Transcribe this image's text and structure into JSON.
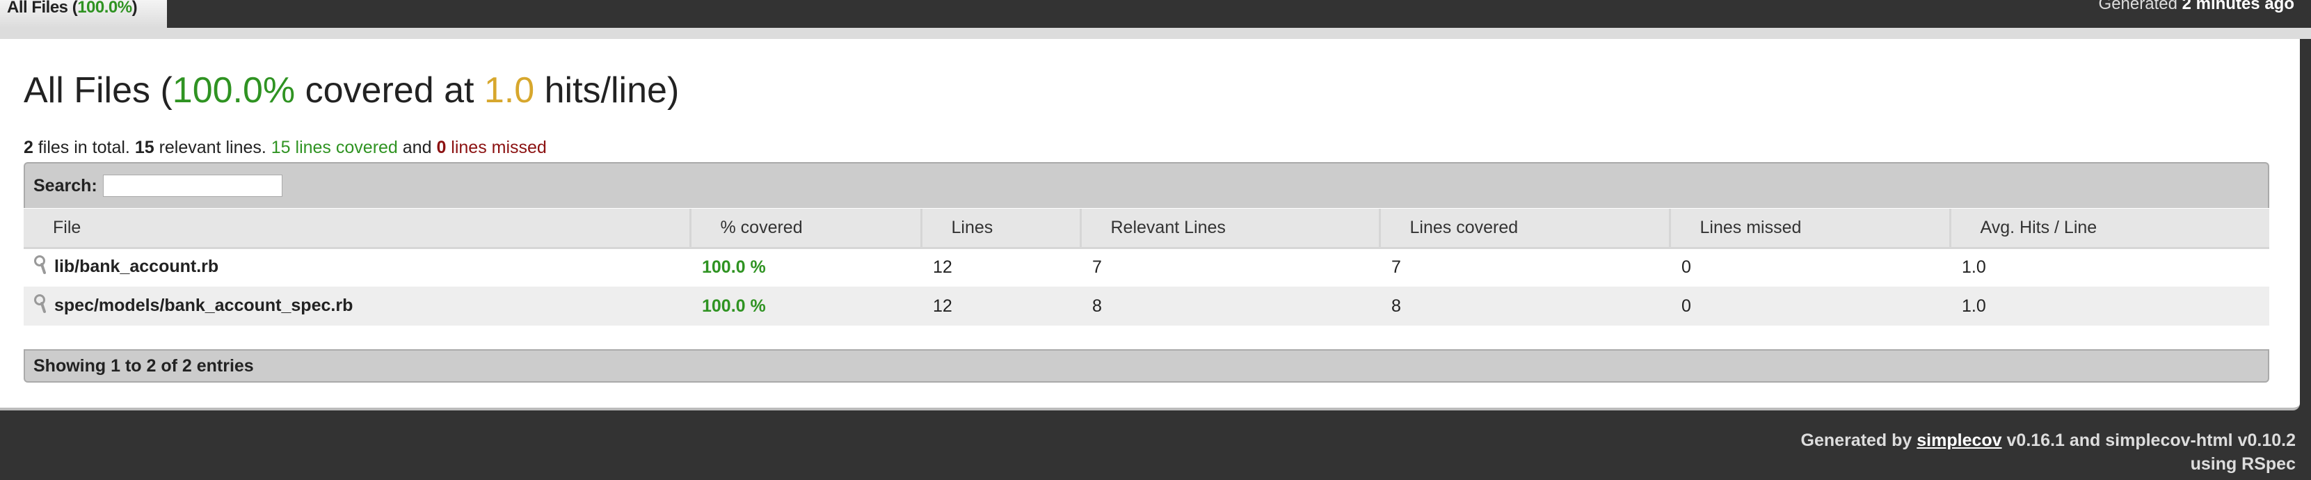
{
  "tab": {
    "label": "All Files",
    "pct": "100.0%"
  },
  "timestamp": {
    "prefix": "Generated",
    "value": "2 minutes ago"
  },
  "title": {
    "prefix": "All Files (",
    "pct": "100.0%",
    "mid": " covered at ",
    "hits": "1.0",
    "suffix": " hits/line)"
  },
  "summary": {
    "files": "2",
    "t1": " files in total. ",
    "relevant": "15",
    "t2": " relevant lines. ",
    "covered": "15 lines covered",
    "t3": " and ",
    "missed_n": "0",
    "missed": " lines missed"
  },
  "search": {
    "label": "Search:",
    "value": ""
  },
  "columns": [
    "File",
    "% covered",
    "Lines",
    "Relevant Lines",
    "Lines covered",
    "Lines missed",
    "Avg. Hits / Line"
  ],
  "rows": [
    {
      "file": "lib/bank_account.rb",
      "pct": "100.0 %",
      "lines": "12",
      "relevant": "7",
      "covered": "7",
      "missed": "0",
      "avg": "1.0"
    },
    {
      "file": "spec/models/bank_account_spec.rb",
      "pct": "100.0 %",
      "lines": "12",
      "relevant": "8",
      "covered": "8",
      "missed": "0",
      "avg": "1.0"
    }
  ],
  "info": "Showing 1 to 2 of 2 entries",
  "footer": {
    "prefix": "Generated by ",
    "link": "simplecov",
    "rest": " v0.16.1 and simplecov-html v0.10.2",
    "line2": "using RSpec"
  },
  "colors": {
    "green": "#2f9322",
    "yellow": "#d7a72d",
    "red": "#8b1111",
    "dark": "#333333"
  }
}
